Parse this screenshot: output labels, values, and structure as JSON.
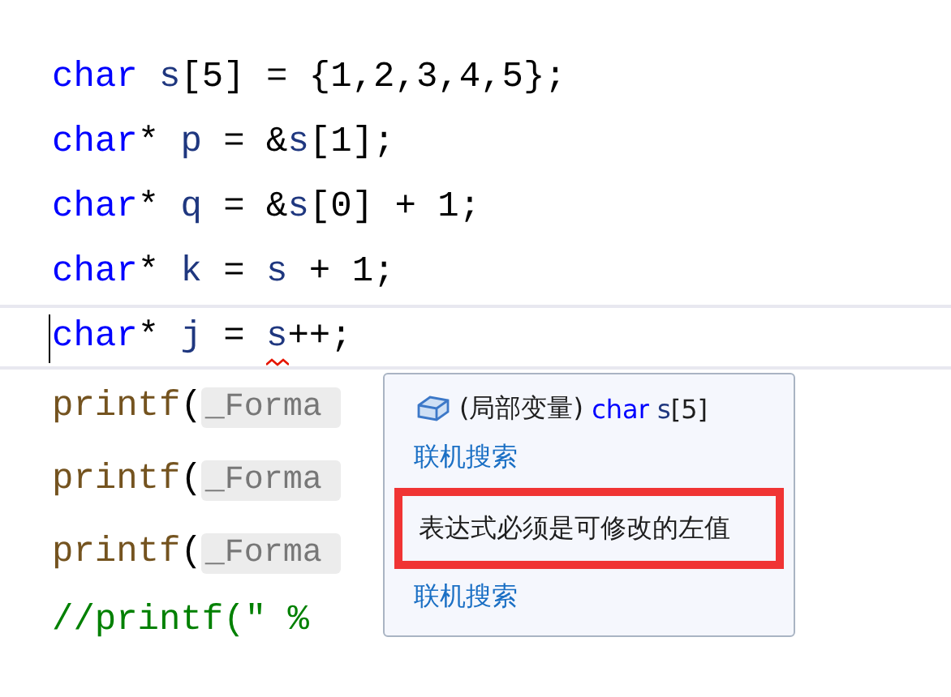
{
  "code_lines": [
    {
      "current": false,
      "tokens": [
        {
          "kind": "keyword",
          "text": "char"
        },
        {
          "kind": "ident",
          "text": " s"
        },
        {
          "kind": "punct",
          "text": "[5] = {1,2,3,4,5};"
        }
      ]
    },
    {
      "current": false,
      "tokens": [
        {
          "kind": "keyword",
          "text": "char"
        },
        {
          "kind": "punct",
          "text": "*"
        },
        {
          "kind": "ident",
          "text": " p"
        },
        {
          "kind": "punct",
          "text": " = &"
        },
        {
          "kind": "ident",
          "text": "s"
        },
        {
          "kind": "punct",
          "text": "[1];"
        }
      ]
    },
    {
      "current": false,
      "tokens": [
        {
          "kind": "keyword",
          "text": "char"
        },
        {
          "kind": "punct",
          "text": "*"
        },
        {
          "kind": "ident",
          "text": " q"
        },
        {
          "kind": "punct",
          "text": " = &"
        },
        {
          "kind": "ident",
          "text": "s"
        },
        {
          "kind": "punct",
          "text": "[0] + 1;"
        }
      ]
    },
    {
      "current": false,
      "tokens": [
        {
          "kind": "keyword",
          "text": "char"
        },
        {
          "kind": "punct",
          "text": "*"
        },
        {
          "kind": "ident",
          "text": " k"
        },
        {
          "kind": "punct",
          "text": " = "
        },
        {
          "kind": "ident",
          "text": "s"
        },
        {
          "kind": "punct",
          "text": " + 1;"
        }
      ]
    },
    {
      "current": true,
      "tokens": [
        {
          "kind": "keyword",
          "text": "char"
        },
        {
          "kind": "punct",
          "text": "*"
        },
        {
          "kind": "ident",
          "text": " j"
        },
        {
          "kind": "punct",
          "text": " = "
        },
        {
          "kind": "error",
          "text": "s"
        },
        {
          "kind": "punct",
          "text": "++;"
        }
      ]
    },
    {
      "current": false,
      "tokens": [
        {
          "kind": "func",
          "text": "printf"
        },
        {
          "kind": "punct",
          "text": "("
        },
        {
          "kind": "hint",
          "text": "_Forma"
        }
      ]
    },
    {
      "current": false,
      "tokens": [
        {
          "kind": "func",
          "text": "printf"
        },
        {
          "kind": "punct",
          "text": "("
        },
        {
          "kind": "hint",
          "text": "_Forma"
        }
      ]
    },
    {
      "current": false,
      "tokens": [
        {
          "kind": "func",
          "text": "printf"
        },
        {
          "kind": "punct",
          "text": "("
        },
        {
          "kind": "hint",
          "text": "_Forma"
        }
      ]
    },
    {
      "current": false,
      "tokens": [
        {
          "kind": "comment",
          "text": "//printf(\" %"
        }
      ]
    }
  ],
  "tooltip": {
    "signature": [
      {
        "kind": "plain",
        "text": "(局部变量) "
      },
      {
        "kind": "keyword",
        "text": "char"
      },
      {
        "kind": "ident",
        "text": " s"
      },
      {
        "kind": "plain",
        "text": "[5]"
      }
    ],
    "items": [
      {
        "kind": "link",
        "text": "联机搜索"
      },
      {
        "kind": "error",
        "text": "表达式必须是可修改的左值"
      },
      {
        "kind": "link",
        "text": "联机搜索"
      }
    ]
  }
}
